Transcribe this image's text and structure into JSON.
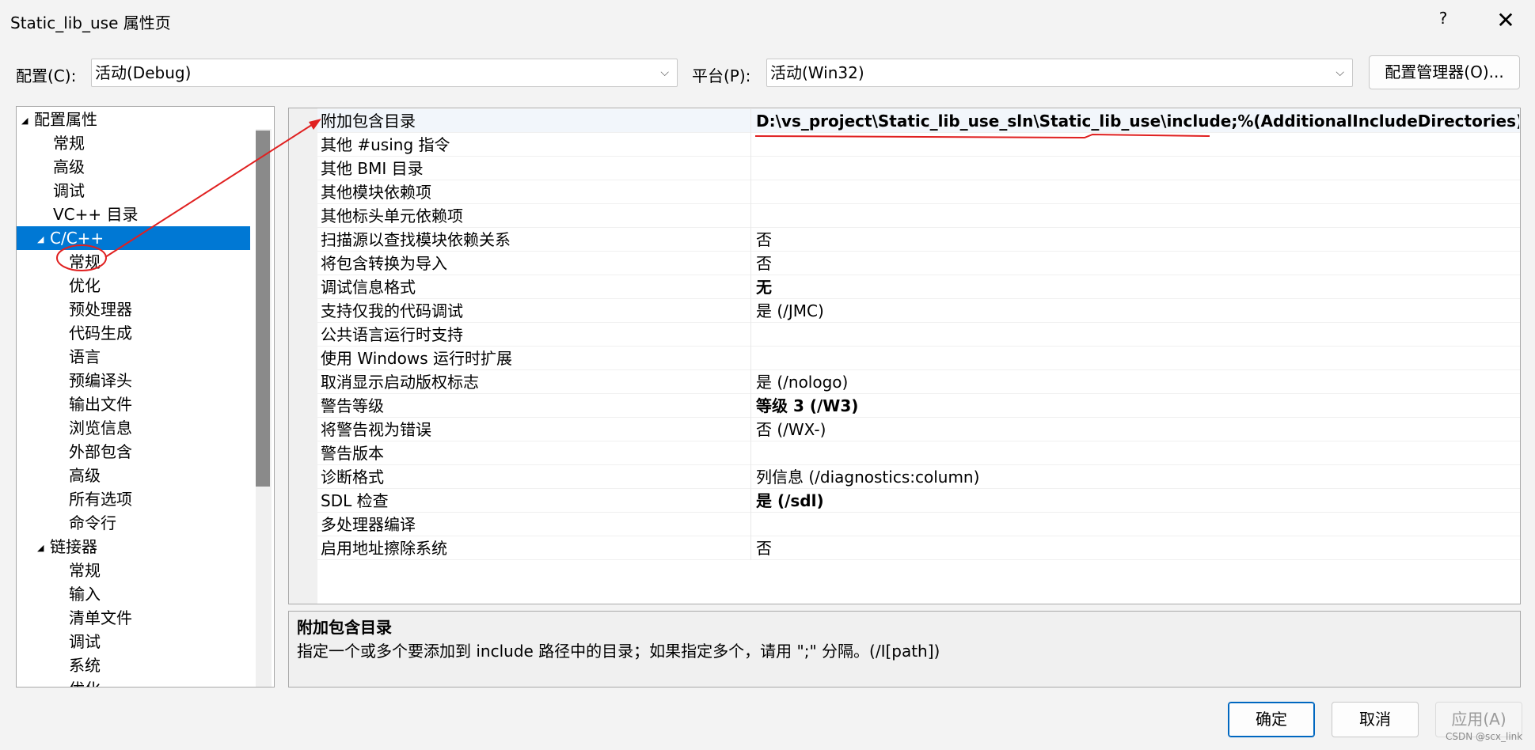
{
  "window": {
    "title": "Static_lib_use 属性页",
    "help_glyph": "?",
    "close_glyph": "✕"
  },
  "config": {
    "config_label": "配置(C):",
    "config_value": "活动(Debug)",
    "platform_label": "平台(P):",
    "platform_value": "活动(Win32)",
    "manager_button": "配置管理器(O)..."
  },
  "tree": {
    "items": [
      {
        "label": "配置属性",
        "level": 0,
        "expander": "◢"
      },
      {
        "label": "常规",
        "level": 1
      },
      {
        "label": "高级",
        "level": 1
      },
      {
        "label": "调试",
        "level": 1
      },
      {
        "label": "VC++ 目录",
        "level": 1
      },
      {
        "label": "C/C++",
        "level": 1,
        "expander": "◢",
        "selected": true
      },
      {
        "label": "常规",
        "level": 2
      },
      {
        "label": "优化",
        "level": 2
      },
      {
        "label": "预处理器",
        "level": 2
      },
      {
        "label": "代码生成",
        "level": 2
      },
      {
        "label": "语言",
        "level": 2
      },
      {
        "label": "预编译头",
        "level": 2
      },
      {
        "label": "输出文件",
        "level": 2
      },
      {
        "label": "浏览信息",
        "level": 2
      },
      {
        "label": "外部包含",
        "level": 2
      },
      {
        "label": "高级",
        "level": 2
      },
      {
        "label": "所有选项",
        "level": 2
      },
      {
        "label": "命令行",
        "level": 2
      },
      {
        "label": "链接器",
        "level": 1,
        "expander": "◢"
      },
      {
        "label": "常规",
        "level": 2
      },
      {
        "label": "输入",
        "level": 2
      },
      {
        "label": "清单文件",
        "level": 2
      },
      {
        "label": "调试",
        "level": 2
      },
      {
        "label": "系统",
        "level": 2
      },
      {
        "label": "优化",
        "level": 2
      }
    ]
  },
  "grid": {
    "rows": [
      {
        "name": "附加包含目录",
        "value": "D:\\vs_project\\Static_lib_use_sln\\Static_lib_use\\include;%(AdditionalIncludeDirectories)",
        "bold": true
      },
      {
        "name": "其他 #using 指令",
        "value": ""
      },
      {
        "name": "其他 BMI 目录",
        "value": ""
      },
      {
        "name": "其他模块依赖项",
        "value": ""
      },
      {
        "name": "其他标头单元依赖项",
        "value": ""
      },
      {
        "name": "扫描源以查找模块依赖关系",
        "value": "否"
      },
      {
        "name": "将包含转换为导入",
        "value": "否"
      },
      {
        "name": "调试信息格式",
        "value": "无",
        "bold": true
      },
      {
        "name": "支持仅我的代码调试",
        "value": "是 (/JMC)"
      },
      {
        "name": "公共语言运行时支持",
        "value": ""
      },
      {
        "name": "使用 Windows 运行时扩展",
        "value": ""
      },
      {
        "name": "取消显示启动版权标志",
        "value": "是 (/nologo)"
      },
      {
        "name": "警告等级",
        "value": "等级 3 (/W3)",
        "bold": true
      },
      {
        "name": "将警告视为错误",
        "value": "否 (/WX-)"
      },
      {
        "name": "警告版本",
        "value": ""
      },
      {
        "name": "诊断格式",
        "value": "列信息 (/diagnostics:column)"
      },
      {
        "name": "SDL 检查",
        "value": "是 (/sdl)",
        "bold": true
      },
      {
        "name": "多处理器编译",
        "value": ""
      },
      {
        "name": "启用地址擦除系统",
        "value": "否"
      }
    ]
  },
  "description": {
    "title": "附加包含目录",
    "text": "指定一个或多个要添加到 include 路径中的目录；如果指定多个，请用 \";\" 分隔。(/I[path])"
  },
  "buttons": {
    "ok": "确定",
    "cancel": "取消",
    "apply": "应用(A)"
  },
  "annotation_color": "#e02020",
  "watermark": "CSDN @scx_link"
}
